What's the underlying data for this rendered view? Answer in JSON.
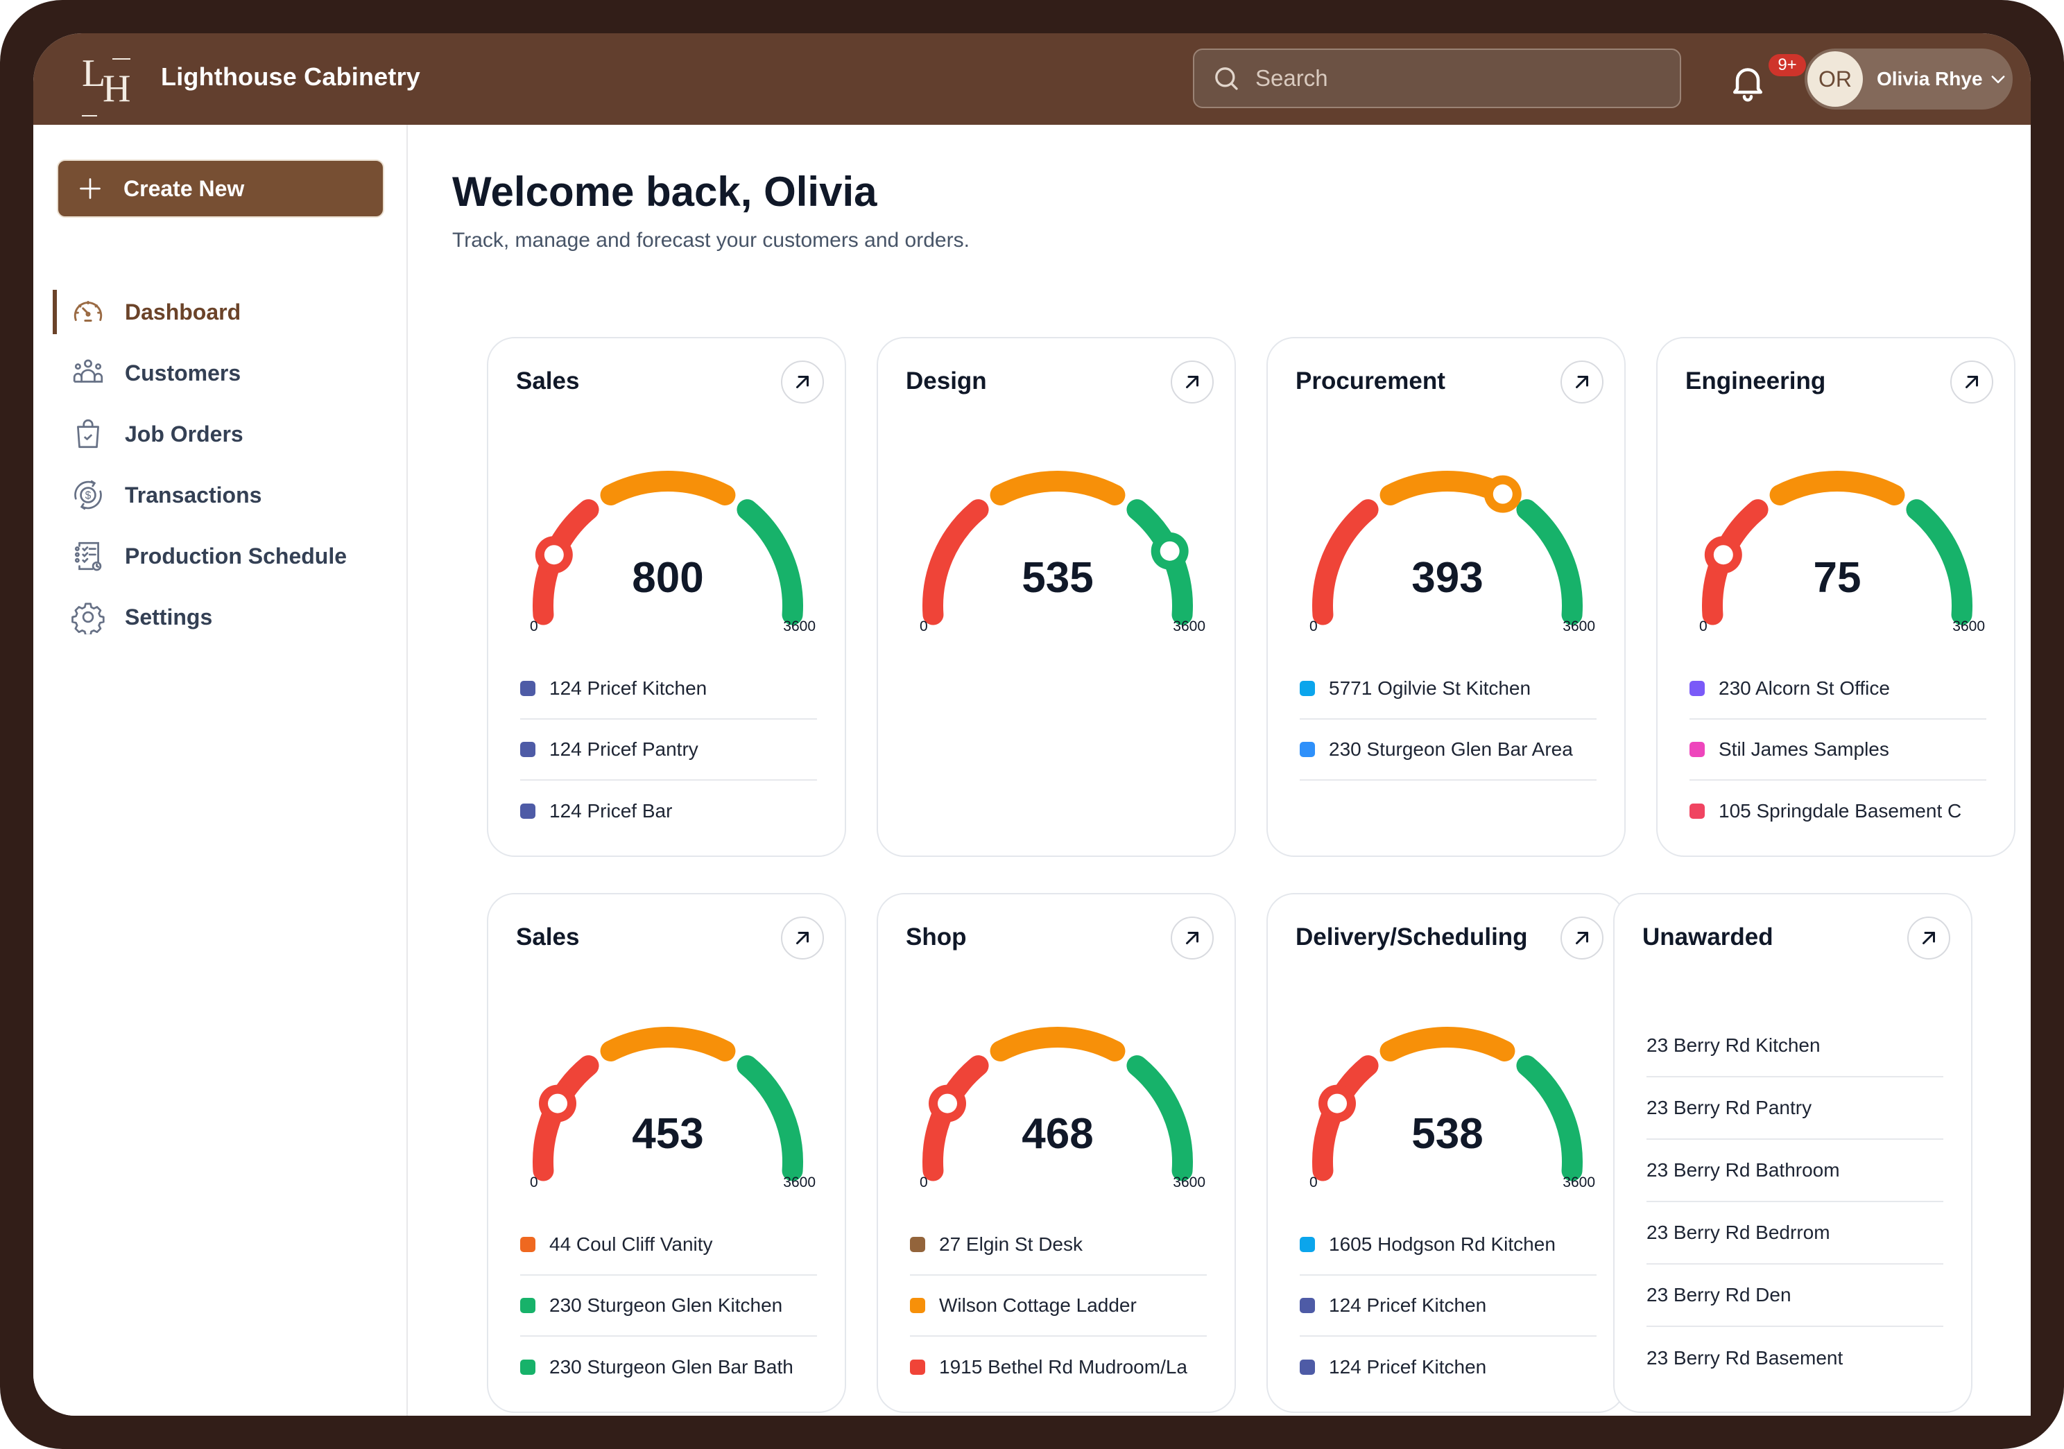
{
  "app": {
    "brand_initials_top": "L",
    "brand_initials_bottom": "H",
    "brand_name": "Lighthouse Cabinetry"
  },
  "header": {
    "search_placeholder": "Search",
    "notification_badge": "9+",
    "user_initials": "OR",
    "user_name": "Olivia Rhye"
  },
  "sidebar": {
    "create_label": "Create New",
    "items": [
      {
        "label": "Dashboard",
        "icon": "dashboard-gauge-icon",
        "active": true
      },
      {
        "label": "Customers",
        "icon": "customers-group-icon",
        "active": false
      },
      {
        "label": "Job Orders",
        "icon": "shopping-bag-check-icon",
        "active": false
      },
      {
        "label": "Transactions",
        "icon": "dollar-cycle-icon",
        "active": false
      },
      {
        "label": "Production Schedule",
        "icon": "checklist-clock-icon",
        "active": false
      },
      {
        "label": "Settings",
        "icon": "gear-icon",
        "active": false
      }
    ]
  },
  "main": {
    "title": "Welcome back, Olivia",
    "subtitle": "Track, manage and forecast your customers and orders."
  },
  "colors": {
    "header_bg": "#623f2e",
    "primary_button": "#774f33",
    "gauge_red": "#ef4438",
    "gauge_orange": "#f79009",
    "gauge_green": "#17b26a"
  },
  "chart_data": {
    "type": "gauge",
    "gauge_min": "0",
    "gauge_max": "3600",
    "cards": [
      {
        "title": "Sales",
        "value": "800",
        "knob_fraction": 0.15,
        "knob_zone": "red",
        "items": [
          {
            "label": "124 Pricef Kitchen",
            "color": "#4e5ba6"
          },
          {
            "label": "124 Pricef Pantry",
            "color": "#4e5ba6"
          },
          {
            "label": "124 Pricef Bar",
            "color": "#4e5ba6"
          }
        ]
      },
      {
        "title": "Design",
        "value": "535",
        "knob_fraction": 0.84,
        "knob_zone": "green",
        "items": []
      },
      {
        "title": "Procurement",
        "value": "393",
        "knob_fraction": 0.64,
        "knob_zone": "orange",
        "items": [
          {
            "label": "5771 Ogilvie St Kitchen",
            "color": "#0ba5ec"
          },
          {
            "label": "230 Sturgeon Glen Bar Area",
            "color": "#2e90fa"
          }
        ]
      },
      {
        "title": "Engineering",
        "value": "75",
        "knob_fraction": 0.15,
        "knob_zone": "red",
        "items": [
          {
            "label": "230 Alcorn St Office",
            "color": "#7a5af8"
          },
          {
            "label": "Stil James Samples",
            "color": "#ee46bc"
          },
          {
            "label": "105 Springdale Basement C",
            "color": "#f04461"
          }
        ]
      },
      {
        "title": "Sales",
        "value": "453",
        "knob_fraction": 0.17,
        "knob_zone": "red",
        "items": [
          {
            "label": "44 Coul Cliff Vanity",
            "color": "#ef6820"
          },
          {
            "label": "230 Sturgeon Glen Kitchen",
            "color": "#17b26a"
          },
          {
            "label": "230 Sturgeon Glen Bar Bath",
            "color": "#17b26a"
          }
        ]
      },
      {
        "title": "Shop",
        "value": "468",
        "knob_fraction": 0.17,
        "knob_zone": "red",
        "items": [
          {
            "label": "27 Elgin St Desk",
            "color": "#93643b"
          },
          {
            "label": "Wilson Cottage Ladder",
            "color": "#f79009"
          },
          {
            "label": "1915 Bethel Rd Mudroom/La",
            "color": "#f04438"
          }
        ]
      },
      {
        "title": "Delivery/Scheduling",
        "value": "538",
        "knob_fraction": 0.17,
        "knob_zone": "red",
        "items": [
          {
            "label": "1605 Hodgson Rd Kitchen",
            "color": "#0ba5ec"
          },
          {
            "label": "124 Pricef Kitchen",
            "color": "#4e5ba6"
          },
          {
            "label": "124 Pricef Kitchen",
            "color": "#4e5ba6"
          }
        ]
      }
    ]
  },
  "unawarded": {
    "title": "Unawarded",
    "items": [
      "23 Berry Rd Kitchen",
      "23 Berry Rd Pantry",
      "23 Berry Rd Bathroom",
      "23 Berry Rd Bedrrom",
      "23 Berry Rd Den",
      "23 Berry Rd Basement"
    ]
  }
}
